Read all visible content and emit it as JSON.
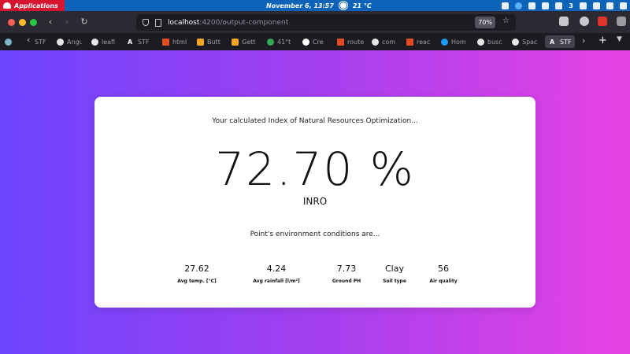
{
  "os_bar": {
    "apps_label": "Applications",
    "datetime": "November  6, 13:57",
    "weather": "21 °C",
    "tray_count": "3"
  },
  "browser": {
    "url_host": "localhost",
    "url_path": ":4200/output-component",
    "zoom": "70%",
    "tabs": [
      {
        "label": "STF",
        "icon": "a-icon"
      },
      {
        "label": "Angu",
        "icon": "github-icon"
      },
      {
        "label": "leafl",
        "icon": "google-icon"
      },
      {
        "label": "STF",
        "icon": "a-icon"
      },
      {
        "label": "html",
        "icon": "html-icon"
      },
      {
        "label": "Butt",
        "icon": "brave-icon"
      },
      {
        "label": "Gett",
        "icon": "brave-icon"
      },
      {
        "label": "41°t",
        "icon": "maps-icon"
      },
      {
        "label": "Cre",
        "icon": "flickr-icon"
      },
      {
        "label": "route",
        "icon": "html-icon"
      },
      {
        "label": "com",
        "icon": "google-icon"
      },
      {
        "label": "reac",
        "icon": "html-icon"
      },
      {
        "label": "Hom",
        "icon": "twitter-icon"
      },
      {
        "label": "busc",
        "icon": "google-icon"
      },
      {
        "label": "Spac",
        "icon": "github-icon"
      },
      {
        "label": "STF",
        "icon": "a-icon"
      }
    ]
  },
  "result": {
    "intro": "Your calculated Index of Natural Resources Optimization...",
    "value": "72.70 %",
    "unit": "INRO",
    "conditions_intro": "Point's environment conditions are...",
    "metrics": [
      {
        "value": "27.62",
        "label": "Avg temp. [°C]"
      },
      {
        "value": "4.24",
        "label": "Avg rainfall [l/m²]"
      },
      {
        "value": "7.73",
        "label": "Ground PH"
      },
      {
        "value": "Clay",
        "label": "Soil type"
      },
      {
        "value": "56",
        "label": "Air quality"
      }
    ]
  },
  "colors": {
    "os_bar": "#0d63b7",
    "apps_button": "#d7152f",
    "gradient_start": "#6d44ff",
    "gradient_end": "#e842e4"
  }
}
